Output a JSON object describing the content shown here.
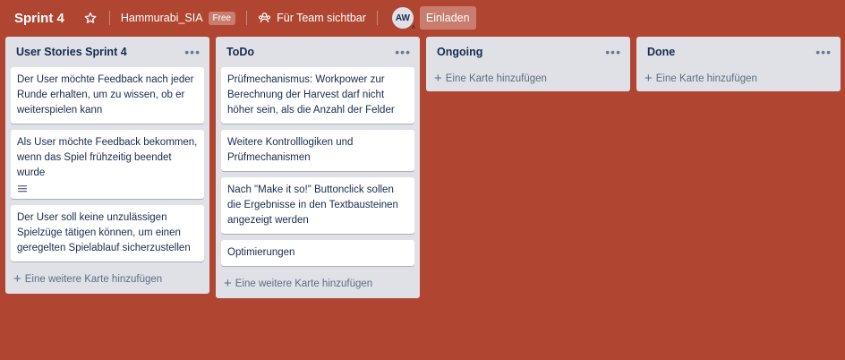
{
  "header": {
    "title": "Sprint 4",
    "team_name": "Hammurabi_SIA",
    "team_badge": "Free",
    "visibility_label": "Für Team sichtbar",
    "avatar_initials": "AW",
    "invite_label": "Einladen"
  },
  "lists": [
    {
      "title": "User Stories Sprint 4",
      "cards": [
        {
          "text": "Der User möchte Feedback nach jeder Runde erhalten, um zu wissen, ob er weiterspielen kann"
        },
        {
          "text": "Als User möchte Feedback bekommen, wenn das Spiel frühzeitig beendet wurde",
          "has_description": true
        },
        {
          "text": "Der User soll keine unzulässigen Spielzüge tätigen können, um einen geregelten Spielablauf sicherzustellen"
        }
      ],
      "add_label": "Eine weitere Karte hinzufügen"
    },
    {
      "title": "ToDo",
      "cards": [
        {
          "text": "Prüfmechanismus: Workpower zur Berechnung der Harvest darf nicht höher sein, als die Anzahl der Felder"
        },
        {
          "text": "Weitere Kontrolllogiken und Prüfmechanismen"
        },
        {
          "text": "Nach \"Make it so!\" Buttonclick sollen die Ergebnisse in den Textbausteinen angezeigt werden"
        },
        {
          "text": "Optimierungen"
        }
      ],
      "add_label": "Eine weitere Karte hinzufügen"
    },
    {
      "title": "Ongoing",
      "cards": [],
      "add_label": "Eine Karte hinzufügen"
    },
    {
      "title": "Done",
      "cards": [],
      "add_label": "Eine Karte hinzufügen"
    }
  ],
  "icons": {
    "star": "star-icon",
    "visibility": "team-visibility-icon",
    "list_menu": "more-dots-icon",
    "description": "description-icon",
    "add": "plus-icon"
  },
  "colors": {
    "board_background": "#b04632",
    "list_background": "#dfe1e6",
    "card_background": "#ffffff",
    "text": "#172b4d"
  }
}
